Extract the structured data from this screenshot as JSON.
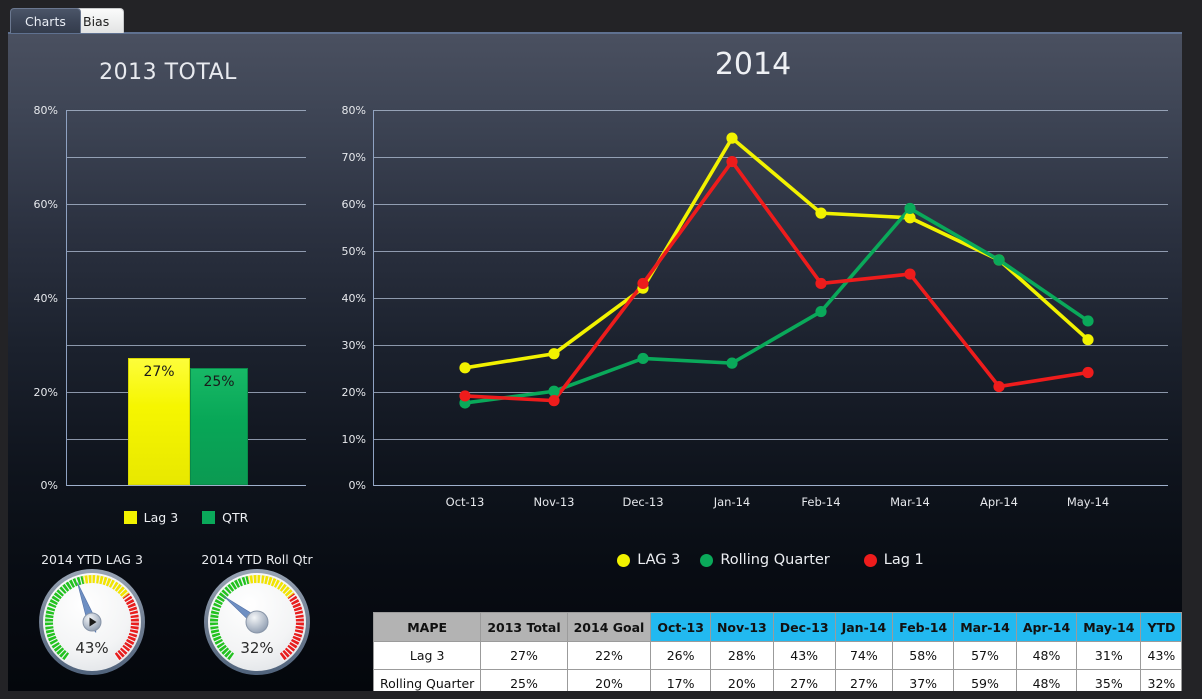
{
  "window": {
    "background_color": "#232326",
    "panel_accent": "#5f7190"
  },
  "tabs": [
    {
      "label": "Charts",
      "active": true
    },
    {
      "label": "Bias",
      "active": false
    }
  ],
  "colors": {
    "lag3": "#f2f200",
    "rolling_quarter": "#0aa95a",
    "lag1": "#ee1c1c",
    "header_gray": "#b3b3b3",
    "header_blue": "#22b9f0",
    "gauge_green": "#22c21f",
    "gauge_yellow": "#f2e400",
    "gauge_red": "#e81d1d"
  },
  "left_chart": {
    "title": "2013 TOTAL",
    "legend": [
      {
        "label": "Lag 3",
        "color": "#f2f200",
        "shape": "square"
      },
      {
        "label": "QTR",
        "color": "#0aa95a",
        "shape": "square"
      }
    ]
  },
  "main_chart": {
    "title": "2014",
    "legend": [
      {
        "label": "LAG 3",
        "color": "#f2f200",
        "shape": "dot"
      },
      {
        "label": "Rolling Quarter",
        "color": "#0aa95a",
        "shape": "dot"
      },
      {
        "label": "Lag 1",
        "color": "#ee1c1c",
        "shape": "dot"
      }
    ]
  },
  "gauges": [
    {
      "caption": "2014 YTD LAG 3",
      "value_label": "43%",
      "value": 43
    },
    {
      "caption": "2014 YTD Roll Qtr",
      "value_label": "32%",
      "value": 32
    }
  ],
  "table": {
    "headers": [
      {
        "label": "MAPE",
        "style": "gray"
      },
      {
        "label": "2013 Total",
        "style": "gray"
      },
      {
        "label": "2014 Goal",
        "style": "gray"
      },
      {
        "label": "Oct-13",
        "style": "blue"
      },
      {
        "label": "Nov-13",
        "style": "blue"
      },
      {
        "label": "Dec-13",
        "style": "blue"
      },
      {
        "label": "Jan-14",
        "style": "blue"
      },
      {
        "label": "Feb-14",
        "style": "blue"
      },
      {
        "label": "Mar-14",
        "style": "blue"
      },
      {
        "label": "Apr-14",
        "style": "blue"
      },
      {
        "label": "May-14",
        "style": "blue"
      },
      {
        "label": "YTD",
        "style": "blue"
      }
    ],
    "rows": [
      {
        "label": "Lag 3",
        "values": [
          "27%",
          "22%",
          "26%",
          "28%",
          "43%",
          "74%",
          "58%",
          "57%",
          "48%",
          "31%",
          "43%"
        ]
      },
      {
        "label": "Rolling Quarter",
        "values": [
          "25%",
          "20%",
          "17%",
          "20%",
          "27%",
          "27%",
          "37%",
          "59%",
          "48%",
          "35%",
          "32%"
        ]
      }
    ]
  },
  "chart_data": [
    {
      "type": "bar",
      "title": "2013 TOTAL",
      "categories": [
        "Lag 3",
        "QTR"
      ],
      "values": [
        27,
        25
      ],
      "value_labels": [
        "27%",
        "25%"
      ],
      "colors": [
        "#f2f200",
        "#0aa95a"
      ],
      "xlabel": "",
      "ylabel": "",
      "ylim": [
        0,
        80
      ],
      "ytick_labels": [
        "0%",
        "20%",
        "40%",
        "60%",
        "80%"
      ],
      "ytick_values": [
        0,
        20,
        40,
        60,
        80
      ],
      "gridline_values": [
        0,
        10,
        20,
        30,
        40,
        50,
        60,
        70,
        80
      ],
      "grid": true,
      "legend_position": "bottom"
    },
    {
      "type": "line",
      "title": "2014",
      "categories": [
        "Oct-13",
        "Nov-13",
        "Dec-13",
        "Jan-14",
        "Feb-14",
        "Mar-14",
        "Apr-14",
        "May-14"
      ],
      "series": [
        {
          "name": "LAG 3",
          "color": "#f2f200",
          "values": [
            25,
            28,
            42,
            74,
            58,
            57,
            48,
            31
          ]
        },
        {
          "name": "Rolling Quarter",
          "color": "#0aa95a",
          "values": [
            17.5,
            20,
            27,
            26,
            37,
            59,
            48,
            35
          ]
        },
        {
          "name": "Lag 1",
          "color": "#ee1c1c",
          "values": [
            19,
            18,
            43,
            69,
            43,
            45,
            21,
            24
          ]
        }
      ],
      "xlabel": "",
      "ylabel": "",
      "ylim": [
        0,
        80
      ],
      "ytick_labels": [
        "0%",
        "10%",
        "20%",
        "30%",
        "40%",
        "50%",
        "60%",
        "70%",
        "80%"
      ],
      "ytick_values": [
        0,
        10,
        20,
        30,
        40,
        50,
        60,
        70,
        80
      ],
      "grid": true,
      "legend_position": "bottom"
    },
    {
      "type": "table",
      "title": "MAPE",
      "columns": [
        "MAPE",
        "2013 Total",
        "2014 Goal",
        "Oct-13",
        "Nov-13",
        "Dec-13",
        "Jan-14",
        "Feb-14",
        "Mar-14",
        "Apr-14",
        "May-14",
        "YTD"
      ],
      "rows": [
        [
          "Lag 3",
          "27%",
          "22%",
          "26%",
          "28%",
          "43%",
          "74%",
          "58%",
          "57%",
          "48%",
          "31%",
          "43%"
        ],
        [
          "Rolling Quarter",
          "25%",
          "20%",
          "17%",
          "20%",
          "27%",
          "27%",
          "37%",
          "59%",
          "48%",
          "35%",
          "32%"
        ]
      ]
    }
  ]
}
